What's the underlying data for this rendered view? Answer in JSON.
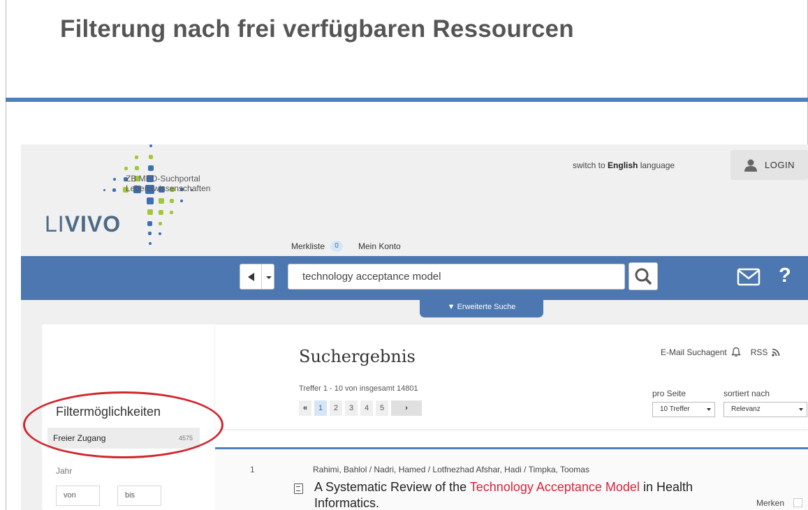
{
  "slide": {
    "title": "Filterung nach frei verfügbaren Ressourcen"
  },
  "colors": {
    "accent_blue": "#4d77b0",
    "highlight_red": "#d4263a",
    "annotation_circle": "#d1262d",
    "logo_green": "#a3c639",
    "logo_blue": "#3d6fb3"
  },
  "header": {
    "logo_text_light": "LI",
    "logo_text_bold": "VIVO",
    "logo_sub_line1": "ZB MED-Suchportal",
    "logo_sub_line2": "Lebenswissenschaften",
    "lang_prefix": "switch to",
    "lang_bold": "English",
    "lang_suffix": "language",
    "login_label": "LOGIN",
    "merkliste_label": "Merkliste",
    "merkliste_count": "0",
    "konto_label": "Mein Konto"
  },
  "search": {
    "query": "technology acceptance model",
    "advanced_label": "▼ Erweiterte Suche",
    "help_label": "?"
  },
  "sidebar": {
    "title": "Filtermöglichkeiten",
    "filter_label": "Freier Zugang",
    "filter_count": "4575",
    "year_label": "Jahr",
    "year_from_placeholder": "von",
    "year_to_placeholder": "bis"
  },
  "results": {
    "title": "Suchergebnis",
    "agent_label": "E-Mail Suchagent",
    "rss_label": "RSS",
    "hits_text": "Treffer 1 - 10 von insgesamt 14801",
    "pager_prev": "«",
    "pages": [
      "1",
      "2",
      "3",
      "4",
      "5"
    ],
    "pager_next": "›",
    "per_page_label": "pro Seite",
    "per_page_value": "10 Treffer",
    "sort_label": "sortiert nach",
    "sort_value": "Relevanz"
  },
  "record": {
    "number": "1",
    "authors": "Rahimi, Bahlol / Nadri, Hamed / Lotfnezhad Afshar, Hadi / Timpka, Toomas",
    "title_part1": "A Systematic Review of the ",
    "title_highlight": "Technology Acceptance Model",
    "title_part2": " in Health Informatics.",
    "merken_label": "Merken"
  }
}
